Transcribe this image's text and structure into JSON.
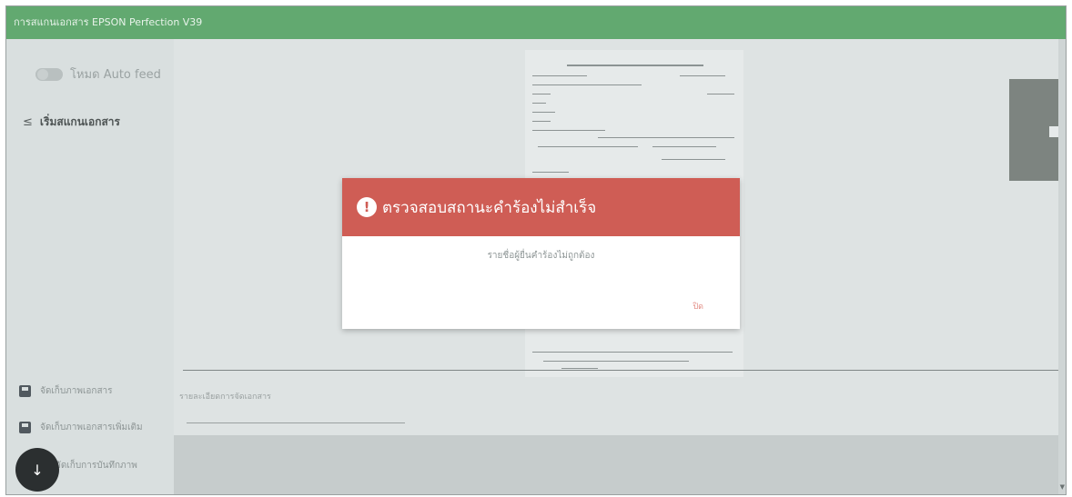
{
  "window": {
    "title": "การสแกนเอกสาร EPSON Perfection V39"
  },
  "sidebar": {
    "auto_feed_label": "โหมด Auto feed",
    "scan_label": "เริ่มสแกนเอกสาร",
    "items": [
      {
        "label": "จัดเก็บภาพเอกสาร",
        "icon": "save-icon"
      },
      {
        "label": "จัดเก็บภาพเอกสารเพิ่มเติม",
        "icon": "save-icon"
      },
      {
        "label": "จัดเก็บการบันทึกภาพ",
        "icon": "save-icon"
      }
    ]
  },
  "main": {
    "doc_name_label": "รายละเอียดการจัดเอกสาร"
  },
  "modal": {
    "title": "ตรวจสอบสถานะคำร้องไม่สำเร็จ",
    "message": "รายชื่อผู้ยื่นคำร้องไม่ถูกต้อง",
    "ok_label": "ปิด",
    "header_color": "#cf5d55"
  }
}
